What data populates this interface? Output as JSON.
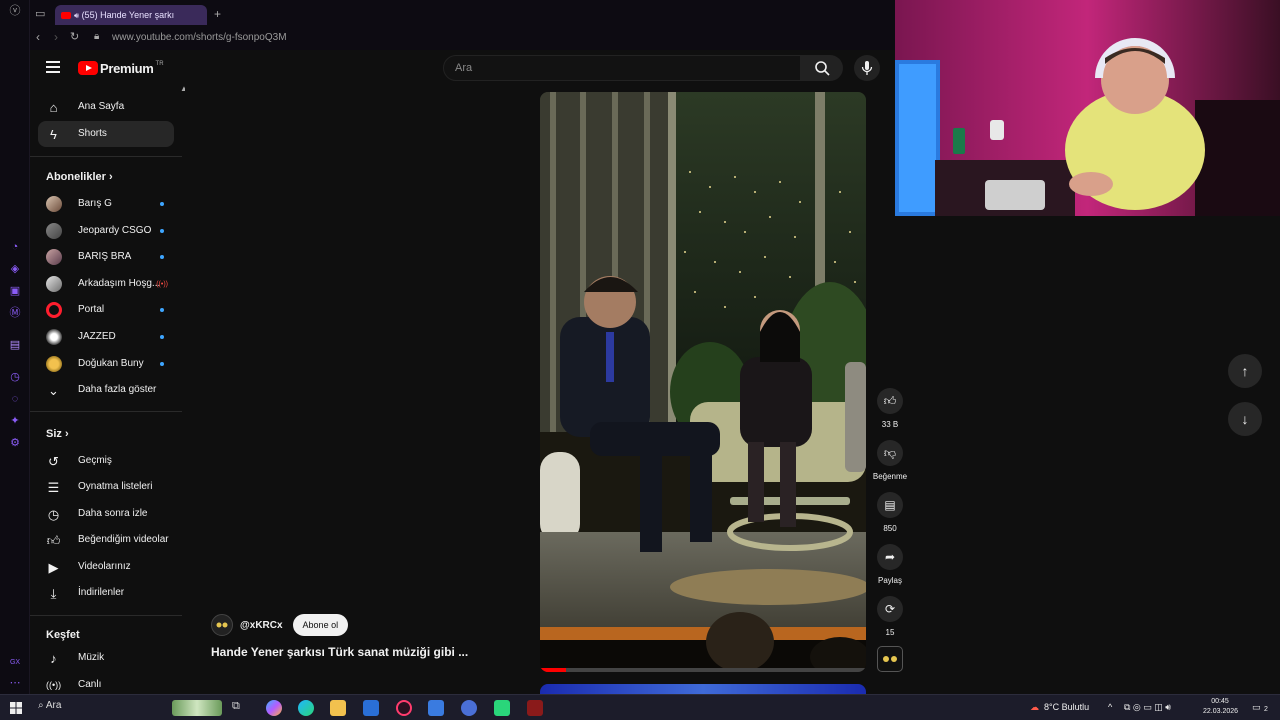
{
  "browser": {
    "tab_title": "(55) Hande Yener şarkı",
    "new_tab_label": "+",
    "url": "www.youtube.com/shorts/g-fsonpoQ3M"
  },
  "youtube": {
    "brand": "Premium",
    "region": "TR",
    "search_placeholder": "Ara"
  },
  "sidebar": {
    "main": [
      {
        "label": "Ana Sayfa",
        "icon": "home-icon"
      },
      {
        "label": "Shorts",
        "icon": "shorts-icon"
      }
    ],
    "subscriptions_header": "Abonelikler",
    "subscriptions": [
      {
        "label": "Barış G",
        "badge": "new-dot"
      },
      {
        "label": "Jeopardy CSGO",
        "badge": "new-dot"
      },
      {
        "label": "BARIŞ BRA",
        "badge": "new-dot"
      },
      {
        "label": "Arkadaşım Hoşg...",
        "badge": "live"
      },
      {
        "label": "Portal",
        "badge": "new-dot"
      },
      {
        "label": "JAZZED",
        "badge": "new-dot"
      },
      {
        "label": "Doğukan Buny",
        "badge": "new-dot"
      }
    ],
    "show_more": "Daha fazla göster",
    "you_header": "Siz",
    "you_items": [
      {
        "label": "Geçmiş",
        "icon": "history-icon"
      },
      {
        "label": "Oynatma listeleri",
        "icon": "playlist-icon"
      },
      {
        "label": "Daha sonra izle",
        "icon": "clock-icon"
      },
      {
        "label": "Beğendiğim videolar",
        "icon": "thumbs-up-icon"
      },
      {
        "label": "Videolarınız",
        "icon": "video-icon"
      },
      {
        "label": "İndirilenler",
        "icon": "download-icon"
      }
    ],
    "explore_header": "Keşfet",
    "explore_items": [
      {
        "label": "Müzik",
        "icon": "music-icon"
      },
      {
        "label": "Canlı",
        "icon": "live-icon"
      }
    ]
  },
  "short": {
    "channel": "@xKRCx",
    "subscribe_label": "Abone ol",
    "title": "Hande Yener şarkısı Türk sanat müziği gibi ..."
  },
  "actions": {
    "likes": "33 B",
    "dislike": "Beğenme",
    "comments": "850",
    "share": "Paylaş",
    "remix": "15"
  },
  "taskbar": {
    "search": "Ara",
    "weather": "8°C  Bulutlu",
    "time": "00:45",
    "date": "22.03.2026",
    "notifications": "2"
  }
}
